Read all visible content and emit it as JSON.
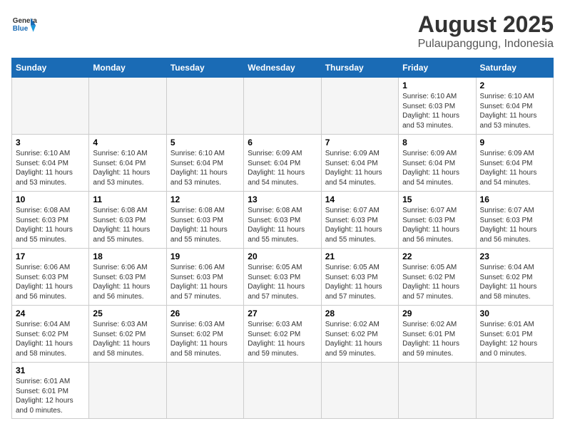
{
  "header": {
    "logo_general": "General",
    "logo_blue": "Blue",
    "month_title": "August 2025",
    "location": "Pulaupanggung, Indonesia"
  },
  "weekdays": [
    "Sunday",
    "Monday",
    "Tuesday",
    "Wednesday",
    "Thursday",
    "Friday",
    "Saturday"
  ],
  "weeks": [
    [
      {
        "day": "",
        "info": ""
      },
      {
        "day": "",
        "info": ""
      },
      {
        "day": "",
        "info": ""
      },
      {
        "day": "",
        "info": ""
      },
      {
        "day": "",
        "info": ""
      },
      {
        "day": "1",
        "info": "Sunrise: 6:10 AM\nSunset: 6:03 PM\nDaylight: 11 hours\nand 53 minutes."
      },
      {
        "day": "2",
        "info": "Sunrise: 6:10 AM\nSunset: 6:04 PM\nDaylight: 11 hours\nand 53 minutes."
      }
    ],
    [
      {
        "day": "3",
        "info": "Sunrise: 6:10 AM\nSunset: 6:04 PM\nDaylight: 11 hours\nand 53 minutes."
      },
      {
        "day": "4",
        "info": "Sunrise: 6:10 AM\nSunset: 6:04 PM\nDaylight: 11 hours\nand 53 minutes."
      },
      {
        "day": "5",
        "info": "Sunrise: 6:10 AM\nSunset: 6:04 PM\nDaylight: 11 hours\nand 53 minutes."
      },
      {
        "day": "6",
        "info": "Sunrise: 6:09 AM\nSunset: 6:04 PM\nDaylight: 11 hours\nand 54 minutes."
      },
      {
        "day": "7",
        "info": "Sunrise: 6:09 AM\nSunset: 6:04 PM\nDaylight: 11 hours\nand 54 minutes."
      },
      {
        "day": "8",
        "info": "Sunrise: 6:09 AM\nSunset: 6:04 PM\nDaylight: 11 hours\nand 54 minutes."
      },
      {
        "day": "9",
        "info": "Sunrise: 6:09 AM\nSunset: 6:04 PM\nDaylight: 11 hours\nand 54 minutes."
      }
    ],
    [
      {
        "day": "10",
        "info": "Sunrise: 6:08 AM\nSunset: 6:03 PM\nDaylight: 11 hours\nand 55 minutes."
      },
      {
        "day": "11",
        "info": "Sunrise: 6:08 AM\nSunset: 6:03 PM\nDaylight: 11 hours\nand 55 minutes."
      },
      {
        "day": "12",
        "info": "Sunrise: 6:08 AM\nSunset: 6:03 PM\nDaylight: 11 hours\nand 55 minutes."
      },
      {
        "day": "13",
        "info": "Sunrise: 6:08 AM\nSunset: 6:03 PM\nDaylight: 11 hours\nand 55 minutes."
      },
      {
        "day": "14",
        "info": "Sunrise: 6:07 AM\nSunset: 6:03 PM\nDaylight: 11 hours\nand 55 minutes."
      },
      {
        "day": "15",
        "info": "Sunrise: 6:07 AM\nSunset: 6:03 PM\nDaylight: 11 hours\nand 56 minutes."
      },
      {
        "day": "16",
        "info": "Sunrise: 6:07 AM\nSunset: 6:03 PM\nDaylight: 11 hours\nand 56 minutes."
      }
    ],
    [
      {
        "day": "17",
        "info": "Sunrise: 6:06 AM\nSunset: 6:03 PM\nDaylight: 11 hours\nand 56 minutes."
      },
      {
        "day": "18",
        "info": "Sunrise: 6:06 AM\nSunset: 6:03 PM\nDaylight: 11 hours\nand 56 minutes."
      },
      {
        "day": "19",
        "info": "Sunrise: 6:06 AM\nSunset: 6:03 PM\nDaylight: 11 hours\nand 57 minutes."
      },
      {
        "day": "20",
        "info": "Sunrise: 6:05 AM\nSunset: 6:03 PM\nDaylight: 11 hours\nand 57 minutes."
      },
      {
        "day": "21",
        "info": "Sunrise: 6:05 AM\nSunset: 6:03 PM\nDaylight: 11 hours\nand 57 minutes."
      },
      {
        "day": "22",
        "info": "Sunrise: 6:05 AM\nSunset: 6:02 PM\nDaylight: 11 hours\nand 57 minutes."
      },
      {
        "day": "23",
        "info": "Sunrise: 6:04 AM\nSunset: 6:02 PM\nDaylight: 11 hours\nand 58 minutes."
      }
    ],
    [
      {
        "day": "24",
        "info": "Sunrise: 6:04 AM\nSunset: 6:02 PM\nDaylight: 11 hours\nand 58 minutes."
      },
      {
        "day": "25",
        "info": "Sunrise: 6:03 AM\nSunset: 6:02 PM\nDaylight: 11 hours\nand 58 minutes."
      },
      {
        "day": "26",
        "info": "Sunrise: 6:03 AM\nSunset: 6:02 PM\nDaylight: 11 hours\nand 58 minutes."
      },
      {
        "day": "27",
        "info": "Sunrise: 6:03 AM\nSunset: 6:02 PM\nDaylight: 11 hours\nand 59 minutes."
      },
      {
        "day": "28",
        "info": "Sunrise: 6:02 AM\nSunset: 6:02 PM\nDaylight: 11 hours\nand 59 minutes."
      },
      {
        "day": "29",
        "info": "Sunrise: 6:02 AM\nSunset: 6:01 PM\nDaylight: 11 hours\nand 59 minutes."
      },
      {
        "day": "30",
        "info": "Sunrise: 6:01 AM\nSunset: 6:01 PM\nDaylight: 12 hours\nand 0 minutes."
      }
    ],
    [
      {
        "day": "31",
        "info": "Sunrise: 6:01 AM\nSunset: 6:01 PM\nDaylight: 12 hours\nand 0 minutes."
      },
      {
        "day": "",
        "info": ""
      },
      {
        "day": "",
        "info": ""
      },
      {
        "day": "",
        "info": ""
      },
      {
        "day": "",
        "info": ""
      },
      {
        "day": "",
        "info": ""
      },
      {
        "day": "",
        "info": ""
      }
    ]
  ]
}
